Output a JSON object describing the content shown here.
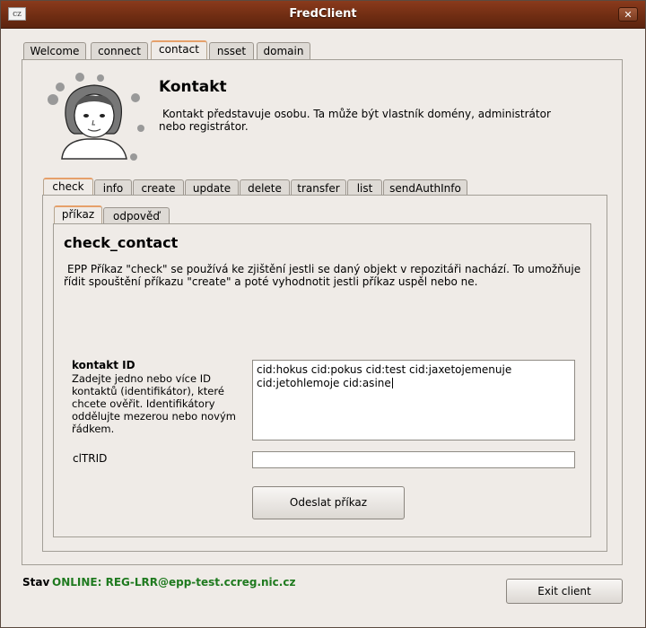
{
  "window": {
    "title": "FredClient",
    "icon_text": "cz",
    "close_symbol": "✕"
  },
  "main_tabs": [
    {
      "label": "Welcome"
    },
    {
      "label": "connect"
    },
    {
      "label": "contact"
    },
    {
      "label": "nsset"
    },
    {
      "label": "domain"
    }
  ],
  "section": {
    "title": "Kontakt",
    "description": "Kontakt představuje osobu. Ta může být vlastník domény, administrátor nebo registrátor."
  },
  "command_tabs": [
    {
      "label": "check"
    },
    {
      "label": "info"
    },
    {
      "label": "create"
    },
    {
      "label": "update"
    },
    {
      "label": "delete"
    },
    {
      "label": "transfer"
    },
    {
      "label": "list"
    },
    {
      "label": "sendAuthInfo"
    }
  ],
  "sub_tabs": [
    {
      "label": "příkaz"
    },
    {
      "label": "odpověď"
    }
  ],
  "command": {
    "title": "check_contact",
    "description": "EPP Příkaz \"check\" se používá ke zjištění jestli se daný objekt v repozitáři nachází. To umožňuje řídit spouštění příkazu \"create\" a poté vyhodnotit jestli příkaz uspěl nebo ne.",
    "field_label": "kontakt ID",
    "field_help": "Zadejte jedno nebo více ID kontaktů (identifikátor), které chcete ověřit. Identifikátory oddělujte mezerou nebo novým řádkem.",
    "field_value": "cid:hokus cid:pokus cid:test cid:jaxetojemenuje\ncid:jetohlemoje cid:asine",
    "cltrid_label": "clTRID",
    "cltrid_value": "",
    "submit_label": "Odeslat příkaz"
  },
  "status": {
    "label": "Stav",
    "value": "ONLINE: REG-LRR@epp-test.ccreg.nic.cz"
  },
  "exit_label": "Exit client",
  "colors": {
    "titlebar": "#6e2c12",
    "active_tab_accent": "#e6a06a",
    "status_online": "#1f7a1f",
    "window_bg": "#efebe7"
  }
}
